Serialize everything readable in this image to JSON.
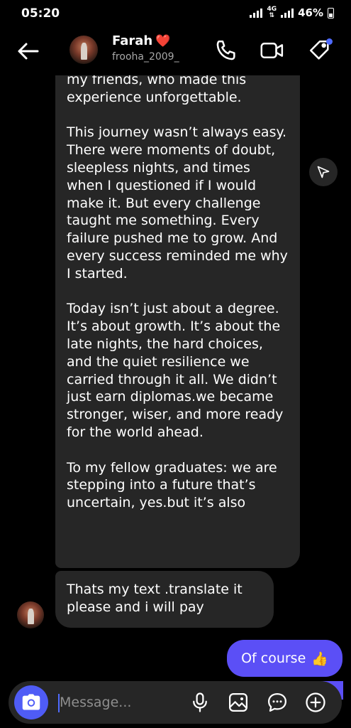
{
  "status_bar": {
    "time": "05:20",
    "network": "4G",
    "battery": "46%"
  },
  "header": {
    "contact_name": "Farah",
    "name_emoji": "❤️",
    "username": "frooha_2009_",
    "icons": [
      "back-arrow-icon",
      "phone-icon",
      "video-camera-icon",
      "tag-icon"
    ]
  },
  "messages": {
    "long_paragraphs": [
      "my friends, who made this experience unforgettable.",
      "This journey wasn’t always easy. There were moments of doubt, sleepless nights, and times when I questioned if I would make it. But every challenge taught me something. Every failure pushed me to grow. And every success reminded me why I started.",
      "Today isn’t just about a degree. It’s about growth. It’s about the late nights, the hard choices, and the quiet resilience we carried through it all. We didn’t just earn diplomas.we became stronger, wiser, and more ready for the world ahead.",
      "To my fellow graduates: we are stepping into a future that’s uncertain, yes.but it’s also"
    ],
    "received_short": "Thats my text .translate it please and i will pay",
    "sent": "Of course",
    "sent_emoji": "👍"
  },
  "composer": {
    "placeholder": "Message..."
  },
  "colors": {
    "accent": "#5b4ff6",
    "bubble_received": "#262626",
    "background": "#000000"
  }
}
